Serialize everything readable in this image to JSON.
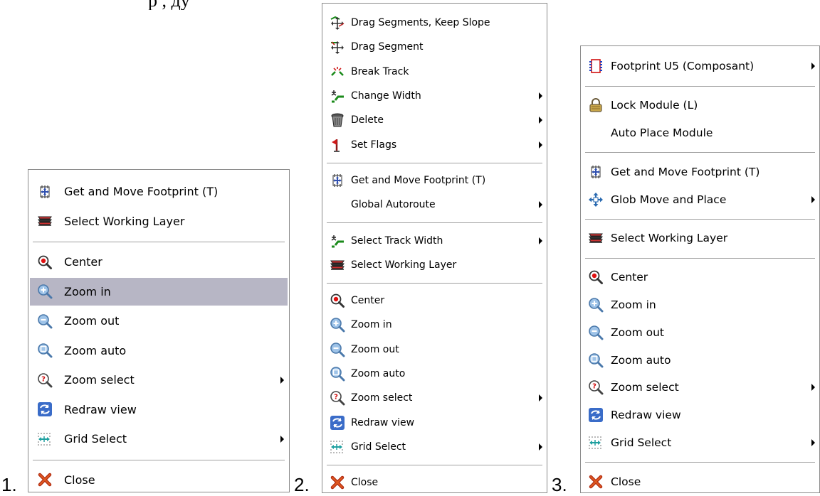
{
  "page": {
    "caption_fragment": "р          ,  ду",
    "labels": [
      "1.",
      "2.",
      "3."
    ]
  },
  "menu1": {
    "items": [
      {
        "label": "Get and Move Footprint (T)",
        "icon": "footprint-move-icon",
        "sub": false
      },
      {
        "label": "Select Working Layer",
        "icon": "layers-icon",
        "sub": false
      },
      {
        "label": "Center",
        "icon": "center-icon",
        "sub": false
      },
      {
        "label": "Zoom in",
        "icon": "zoom-in-icon",
        "sub": false,
        "highlighted": true
      },
      {
        "label": "Zoom out",
        "icon": "zoom-out-icon",
        "sub": false
      },
      {
        "label": "Zoom auto",
        "icon": "zoom-auto-icon",
        "sub": false
      },
      {
        "label": "Zoom select",
        "icon": "zoom-select-icon",
        "sub": true
      },
      {
        "label": "Redraw view",
        "icon": "redraw-icon",
        "sub": false
      },
      {
        "label": "Grid Select",
        "icon": "grid-icon",
        "sub": true
      },
      {
        "label": "Close",
        "icon": "close-icon",
        "sub": false
      }
    ]
  },
  "menu2": {
    "items": [
      {
        "label": "Drag Segments, Keep Slope",
        "icon": "drag-segments-icon",
        "sub": false
      },
      {
        "label": "Drag Segment",
        "icon": "drag-segment-icon",
        "sub": false
      },
      {
        "label": "Break Track",
        "icon": "break-track-icon",
        "sub": false
      },
      {
        "label": "Change Width",
        "icon": "track-width-icon",
        "sub": true
      },
      {
        "label": "Delete",
        "icon": "trash-icon",
        "sub": true
      },
      {
        "label": "Set Flags",
        "icon": "flag-icon",
        "sub": true
      },
      {
        "label": "Get and Move Footprint (T)",
        "icon": "footprint-move-icon",
        "sub": false
      },
      {
        "label": "Global Autoroute",
        "icon": "",
        "sub": true
      },
      {
        "label": "Select Track Width",
        "icon": "track-width-icon",
        "sub": true
      },
      {
        "label": "Select Working Layer",
        "icon": "layers-icon",
        "sub": false
      },
      {
        "label": "Center",
        "icon": "center-icon",
        "sub": false
      },
      {
        "label": "Zoom in",
        "icon": "zoom-in-icon",
        "sub": false
      },
      {
        "label": "Zoom out",
        "icon": "zoom-out-icon",
        "sub": false
      },
      {
        "label": "Zoom auto",
        "icon": "zoom-auto-icon",
        "sub": false
      },
      {
        "label": "Zoom select",
        "icon": "zoom-select-icon",
        "sub": true
      },
      {
        "label": "Redraw view",
        "icon": "redraw-icon",
        "sub": false
      },
      {
        "label": "Grid Select",
        "icon": "grid-icon",
        "sub": true
      },
      {
        "label": "Close",
        "icon": "close-icon",
        "sub": false
      }
    ]
  },
  "menu3": {
    "items": [
      {
        "label": "Footprint U5 (Composant)",
        "icon": "footprint-icon",
        "sub": true
      },
      {
        "label": "Lock Module (L)",
        "icon": "lock-icon",
        "sub": false
      },
      {
        "label": "Auto Place Module",
        "icon": "",
        "sub": false
      },
      {
        "label": "Get and Move Footprint (T)",
        "icon": "footprint-move-icon",
        "sub": false
      },
      {
        "label": "Glob Move and Place",
        "icon": "glob-move-icon",
        "sub": true
      },
      {
        "label": "Select Working Layer",
        "icon": "layers-icon",
        "sub": false
      },
      {
        "label": "Center",
        "icon": "center-icon",
        "sub": false
      },
      {
        "label": "Zoom in",
        "icon": "zoom-in-icon",
        "sub": false
      },
      {
        "label": "Zoom out",
        "icon": "zoom-out-icon",
        "sub": false
      },
      {
        "label": "Zoom auto",
        "icon": "zoom-auto-icon",
        "sub": false
      },
      {
        "label": "Zoom select",
        "icon": "zoom-select-icon",
        "sub": true
      },
      {
        "label": "Redraw view",
        "icon": "redraw-icon",
        "sub": false
      },
      {
        "label": "Grid Select",
        "icon": "grid-icon",
        "sub": true
      },
      {
        "label": "Close",
        "icon": "close-icon",
        "sub": false
      }
    ]
  }
}
